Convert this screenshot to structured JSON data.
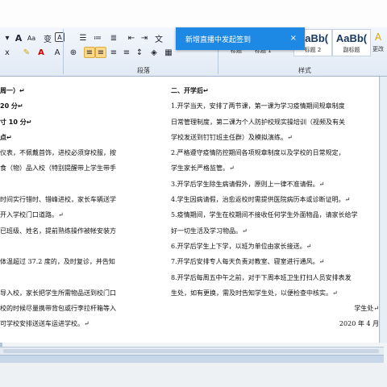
{
  "toast": {
    "text": "新增直播中发起签到",
    "close": "×"
  },
  "ribbon": {
    "font_size_inc": "A",
    "font_size_dec": "Aa",
    "char_btns": [
      "变",
      "A"
    ],
    "para_label": "段落",
    "style_label": "样式",
    "styles": [
      {
        "sample": "AaBb(",
        "name": "标题 2"
      },
      {
        "sample": "AaBb(",
        "name": "副标题"
      }
    ],
    "style_left_partial": [
      "标题",
      "标题 1"
    ],
    "change_label": "更改"
  },
  "doc": {
    "left_lines": [
      "周一）↵",
      "20 分↵",
      "寸 10 分↵",
      "点↵",
      "仪表，不佩戴首饰，进校必须穿校服，按",
      "食（物）品入校（特别提醒带上学生带手",
      "",
      "时间实行错时、错峰进校，家长车辆送学",
      "开入学校门口道路。↵",
      "已班级、姓名，提前熟练操作被帐安装方",
      "",
      "体温超过 37.2 度的，及时复诊，并告知",
      "",
      "导入校，家长把学生所需物品送到校门口",
      "校的时候尽量携带背包或行李拉杆箱等入",
      "可学校安排送送车运进学校。↵"
    ],
    "right_lines": [
      "二、开学后↵",
      "1.开学当天，安排了两节课，第一课为学习疫情期间规章制度",
      "日常管理制度，第二课为个人防护校规实操培训（视频及有关",
      "学校发送到钉钉班主任群）及模拟演练。↵",
      "2.严格遵守疫情防控期间各项规章制度以及学校的日常规定，",
      "学生家长严格监管。↵",
      "3.开学后学生除生病请假外，原则上一律不准请假。↵",
      "4.学生因病请假，治愈返校时需提供医院病历本或诊断证明。↵",
      "5.疫情期间，学生在校期间不接收任何学生外面物品，请家长给学",
      "好一切生活及学习物品。↵",
      "6.开学后学生上下学，以班为单位由家长接送。↵",
      "7.开学后安排专人每天负责对教室、寝室进行通风。↵",
      "8.开学后每周五中午之前，对于下周本班卫生打扫人员安排表发",
      "生处，如有更换，需及时告知学生处，以便检查中核实。↵",
      "学生处↵",
      "2020 年 4 月"
    ]
  }
}
